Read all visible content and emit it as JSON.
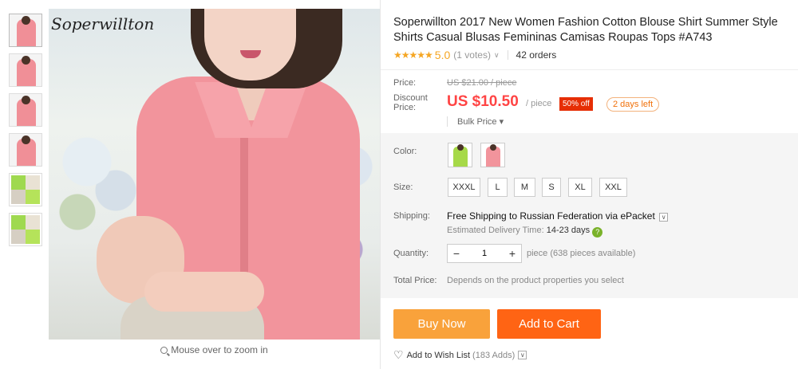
{
  "gallery": {
    "brand": "Soperwillton",
    "zoom_hint": "Mouse over to zoom in",
    "thumbnails": [
      {
        "type": "pink"
      },
      {
        "type": "pink"
      },
      {
        "type": "pink"
      },
      {
        "type": "pink"
      },
      {
        "type": "green"
      },
      {
        "type": "green"
      }
    ]
  },
  "product": {
    "title": "Soperwillton 2017 New Women Fashion Cotton Blouse Shirt Summer Style Shirts Casual Blusas Femininas Camisas Roupas Tops #A743",
    "stars": "★★★★★",
    "rating": "5.0",
    "votes": "(1 votes)",
    "orders": "42 orders"
  },
  "pricing": {
    "price_label": "Price:",
    "old_price": "US $21.00 / piece",
    "discount_label_1": "Discount",
    "discount_label_2": "Price:",
    "new_price": "US $10.50",
    "per_piece": "/ piece",
    "discount_badge": "50% off",
    "days_left": "2 days left",
    "bulk_price": "Bulk Price ▾"
  },
  "sku": {
    "color_label": "Color:",
    "colors": [
      {
        "name": "green",
        "hex": "#a6d948"
      },
      {
        "name": "pink",
        "hex": "#f2949c"
      }
    ],
    "size_label": "Size:",
    "sizes": [
      "XXXL",
      "L",
      "M",
      "S",
      "XL",
      "XXL"
    ],
    "shipping_label": "Shipping:",
    "shipping_text": "Free Shipping to Russian Federation via ePacket",
    "est_label": "Estimated Delivery Time:",
    "est_days": "14-23 days",
    "quantity_label": "Quantity:",
    "quantity_value": "1",
    "quantity_note": "piece (638 pieces available)",
    "total_label": "Total Price:",
    "total_note": "Depends on the product properties you select"
  },
  "actions": {
    "buy_now": "Buy Now",
    "add_to_cart": "Add to Cart",
    "wishlist": "Add to Wish List",
    "wishlist_count": "(183 Adds)"
  },
  "colors": {
    "accent_red": "#ff4444",
    "buy_now": "#f9a23b",
    "add_to_cart": "#ff6414",
    "star": "#f5a623"
  }
}
